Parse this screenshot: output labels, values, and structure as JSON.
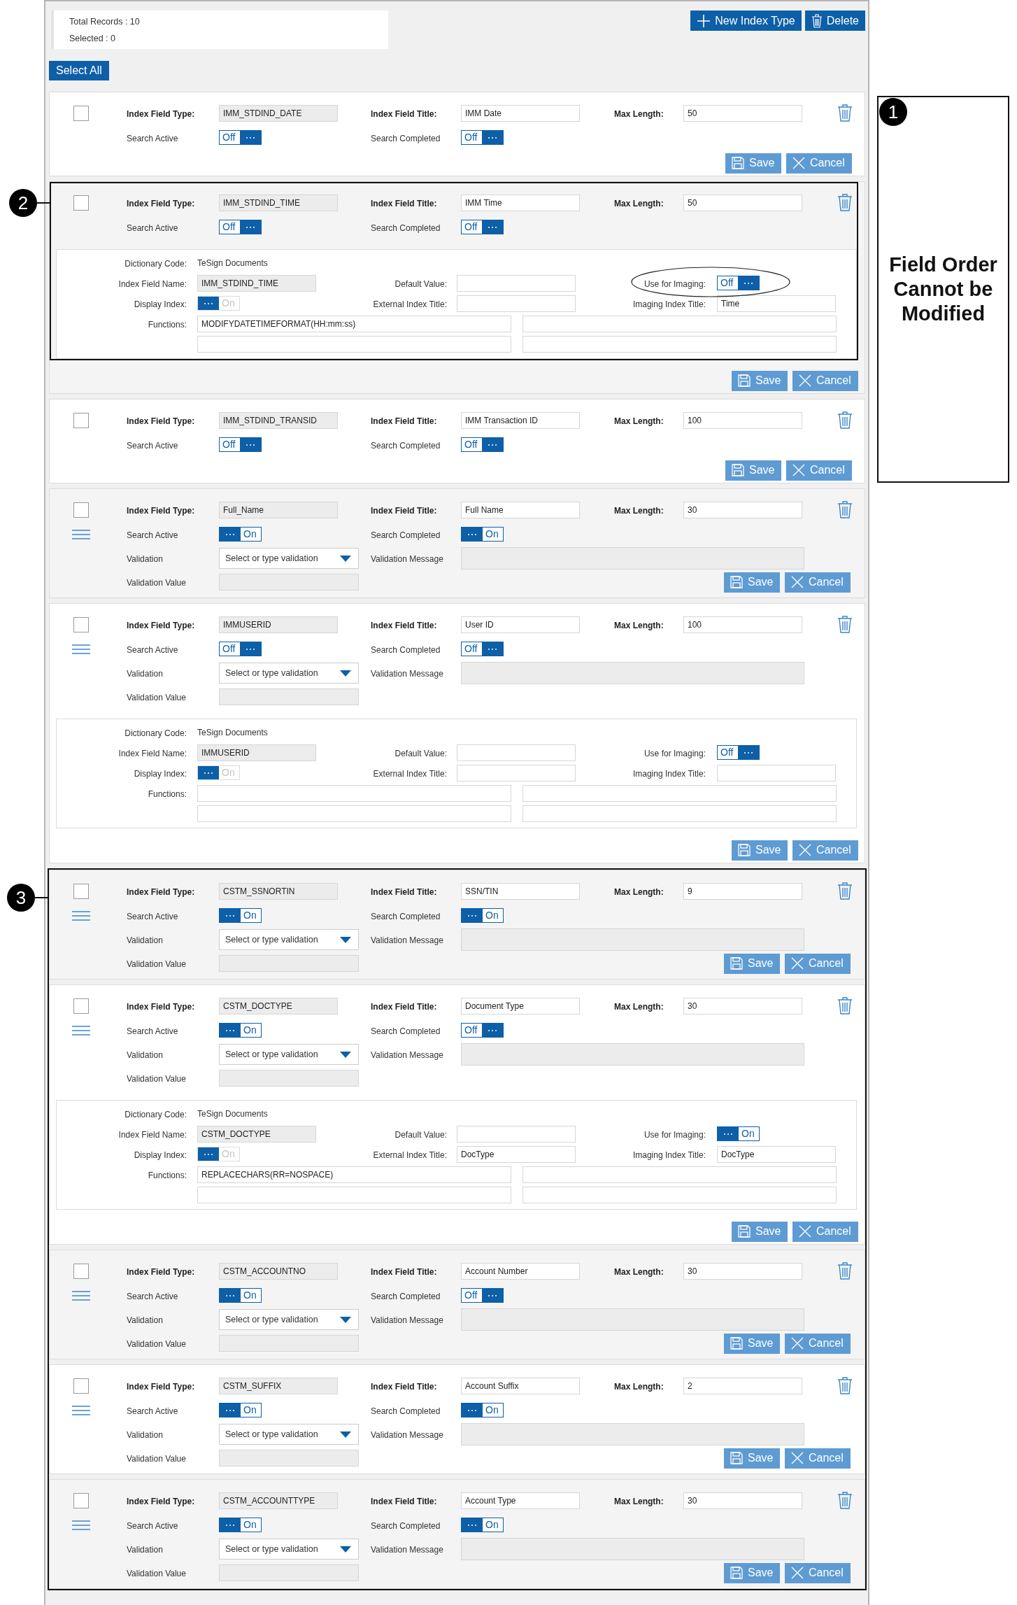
{
  "summary": {
    "total": "Total Records : 10",
    "selected": "Selected : 0"
  },
  "toolbar": {
    "new_button": "New Index Type",
    "delete_button": "Delete",
    "select_all": "Select All"
  },
  "records": [
    {
      "checked": false,
      "drag_handle": false,
      "type_label": "Index Field Type:",
      "type": "IMM_STDIND_DATE",
      "title_label": "Index Field Title:",
      "title": "IMM Date",
      "max_label": "Max Length:",
      "max": "50",
      "search_active": {
        "label": "Search Active",
        "toggle": {
          "text": "Off",
          "on": false
        }
      },
      "search_completed": {
        "label": "Search Completed",
        "toggle": {
          "text": "Off",
          "on": false
        }
      },
      "save": "Save",
      "cancel": "Cancel"
    },
    {
      "checked": false,
      "drag_handle": false,
      "callout": "2",
      "type_label": "Index Field Type:",
      "type": "IMM_STDIND_TIME",
      "title_label": "Index Field Title:",
      "title": "IMM Time",
      "max_label": "Max Length:",
      "max": "50",
      "search_active": {
        "label": "Search Active",
        "toggle": {
          "text": "Off",
          "on": false
        }
      },
      "search_completed": {
        "label": "Search Completed",
        "toggle": {
          "text": "Off",
          "on": false
        }
      },
      "detail": {
        "dictionary_code_label": "Dictionary Code:",
        "dictionary_code": "TeSign Documents",
        "name_label": "Index Field Name:",
        "name": "IMM_STDIND_TIME",
        "display_label": "Display Index:",
        "display_toggle": {
          "text": "On",
          "on": true,
          "disabled": true
        },
        "default_label": "Default Value:",
        "external_label": "External Index Title:",
        "imaging_label": "Use for Imaging:",
        "imaging_toggle": {
          "text": "Off",
          "on": false
        },
        "imaging_circled": true,
        "imaging_title_label": "Imaging Index Title:",
        "imaging_title": "Time",
        "functions_label": "Functions:",
        "functions": [
          "MODIFYDATETIMEFORMAT(HH:mm:ss)"
        ]
      },
      "save": "Save",
      "cancel": "Cancel"
    },
    {
      "checked": false,
      "drag_handle": false,
      "type_label": "Index Field Type:",
      "type": "IMM_STDIND_TRANSID",
      "title_label": "Index Field Title:",
      "title": "IMM Transaction ID",
      "max_label": "Max Length:",
      "max": "100",
      "search_active": {
        "label": "Search Active",
        "toggle": {
          "text": "Off",
          "on": false
        }
      },
      "search_completed": {
        "label": "Search Completed",
        "toggle": {
          "text": "Off",
          "on": false
        }
      },
      "save": "Save",
      "cancel": "Cancel"
    },
    {
      "checked": false,
      "drag_handle": true,
      "type_label": "Index Field Type:",
      "type": "Full_Name",
      "title_label": "Index Field Title:",
      "title": "Full Name",
      "max_label": "Max Length:",
      "max": "30",
      "search_active": {
        "label": "Search Active",
        "toggle": {
          "text": "On",
          "on": true
        }
      },
      "search_completed": {
        "label": "Search Completed",
        "toggle": {
          "text": "On",
          "on": true
        }
      },
      "validation": {
        "label": "Validation",
        "placeholder": "Select or type validation",
        "message_label": "Validation Message",
        "value_label": "Validation Value"
      },
      "save": "Save",
      "cancel": "Cancel"
    },
    {
      "checked": false,
      "drag_handle": true,
      "type_label": "Index Field Type:",
      "type": "IMMUSERID",
      "title_label": "Index Field Title:",
      "title": "User ID",
      "max_label": "Max Length:",
      "max": "100",
      "search_active": {
        "label": "Search Active",
        "toggle": {
          "text": "Off",
          "on": false
        }
      },
      "search_completed": {
        "label": "Search Completed",
        "toggle": {
          "text": "Off",
          "on": false
        }
      },
      "validation": {
        "label": "Validation",
        "placeholder": "Select or type validation",
        "message_label": "Validation Message",
        "value_label": "Validation Value"
      },
      "detail": {
        "dictionary_code_label": "Dictionary Code:",
        "dictionary_code": "TeSign Documents",
        "name_label": "Index Field Name:",
        "name": "IMMUSERID",
        "display_label": "Display Index:",
        "display_toggle": {
          "text": "On",
          "on": true,
          "disabled": true
        },
        "default_label": "Default Value:",
        "external_label": "External Index Title:",
        "imaging_label": "Use for Imaging:",
        "imaging_toggle": {
          "text": "Off",
          "on": false
        },
        "imaging_title_label": "Imaging Index Title:",
        "functions_label": "Functions:"
      },
      "save": "Save",
      "cancel": "Cancel"
    }
  ],
  "callout_group": {
    "number": "3",
    "records": [
      {
        "checked": false,
        "drag_handle": true,
        "type_label": "Index Field Type:",
        "type": "CSTM_SSNORTIN",
        "title_label": "Index Field Title:",
        "title": "SSN/TIN",
        "max_label": "Max Length:",
        "max": "9",
        "search_active": {
          "label": "Search Active",
          "toggle": {
            "text": "On",
            "on": true
          }
        },
        "search_completed": {
          "label": "Search Completed",
          "toggle": {
            "text": "On",
            "on": true
          }
        },
        "validation": {
          "label": "Validation",
          "placeholder": "Select or type validation",
          "message_label": "Validation Message",
          "value_label": "Validation Value"
        },
        "save": "Save",
        "cancel": "Cancel"
      },
      {
        "checked": false,
        "drag_handle": true,
        "type_label": "Index Field Type:",
        "type": "CSTM_DOCTYPE",
        "title_label": "Index Field Title:",
        "title": "Document Type",
        "max_label": "Max Length:",
        "max": "30",
        "search_active": {
          "label": "Search Active",
          "toggle": {
            "text": "On",
            "on": true
          }
        },
        "search_completed": {
          "label": "Search Completed",
          "toggle": {
            "text": "Off",
            "on": false
          }
        },
        "validation": {
          "label": "Validation",
          "placeholder": "Select or type validation",
          "message_label": "Validation Message",
          "value_label": "Validation Value"
        },
        "detail": {
          "dictionary_code_label": "Dictionary Code:",
          "dictionary_code": "TeSign Documents",
          "name_label": "Index Field Name:",
          "name": "CSTM_DOCTYPE",
          "display_label": "Display Index:",
          "display_toggle": {
            "text": "On",
            "on": true,
            "disabled": true
          },
          "default_label": "Default Value:",
          "external_label": "External Index Title:",
          "external_title": "DocType",
          "imaging_label": "Use for Imaging:",
          "imaging_toggle": {
            "text": "On",
            "on": true
          },
          "imaging_title_label": "Imaging Index Title:",
          "imaging_title": "DocType",
          "functions_label": "Functions:",
          "functions": [
            "REPLACECHARS(RR=NOSPACE)"
          ]
        },
        "save": "Save",
        "cancel": "Cancel"
      },
      {
        "checked": false,
        "drag_handle": true,
        "type_label": "Index Field Type:",
        "type": "CSTM_ACCOUNTNO",
        "title_label": "Index Field Title:",
        "title": "Account Number",
        "max_label": "Max Length:",
        "max": "30",
        "search_active": {
          "label": "Search Active",
          "toggle": {
            "text": "On",
            "on": true
          }
        },
        "search_completed": {
          "label": "Search Completed",
          "toggle": {
            "text": "Off",
            "on": false
          }
        },
        "validation": {
          "label": "Validation",
          "placeholder": "Select or type validation",
          "message_label": "Validation Message",
          "value_label": "Validation Value"
        },
        "save": "Save",
        "cancel": "Cancel"
      },
      {
        "checked": false,
        "drag_handle": true,
        "type_label": "Index Field Type:",
        "type": "CSTM_SUFFIX",
        "title_label": "Index Field Title:",
        "title": "Account Suffix",
        "max_label": "Max Length:",
        "max": "2",
        "search_active": {
          "label": "Search Active",
          "toggle": {
            "text": "On",
            "on": true
          }
        },
        "search_completed": {
          "label": "Search Completed",
          "toggle": {
            "text": "On",
            "on": true
          }
        },
        "validation": {
          "label": "Validation",
          "placeholder": "Select or type validation",
          "message_label": "Validation Message",
          "value_label": "Validation Value"
        },
        "save": "Save",
        "cancel": "Cancel"
      },
      {
        "checked": false,
        "drag_handle": true,
        "type_label": "Index Field Type:",
        "type": "CSTM_ACCOUNTTYPE",
        "title_label": "Index Field Title:",
        "title": "Account Type",
        "max_label": "Max Length:",
        "max": "30",
        "search_active": {
          "label": "Search Active",
          "toggle": {
            "text": "On",
            "on": true
          }
        },
        "search_completed": {
          "label": "Search Completed",
          "toggle": {
            "text": "On",
            "on": true
          }
        },
        "validation": {
          "label": "Validation",
          "placeholder": "Select or type validation",
          "message_label": "Validation Message",
          "value_label": "Validation Value"
        },
        "save": "Save",
        "cancel": "Cancel"
      }
    ]
  },
  "note": {
    "number": "1",
    "text": "Field Order Cannot be Modified"
  }
}
